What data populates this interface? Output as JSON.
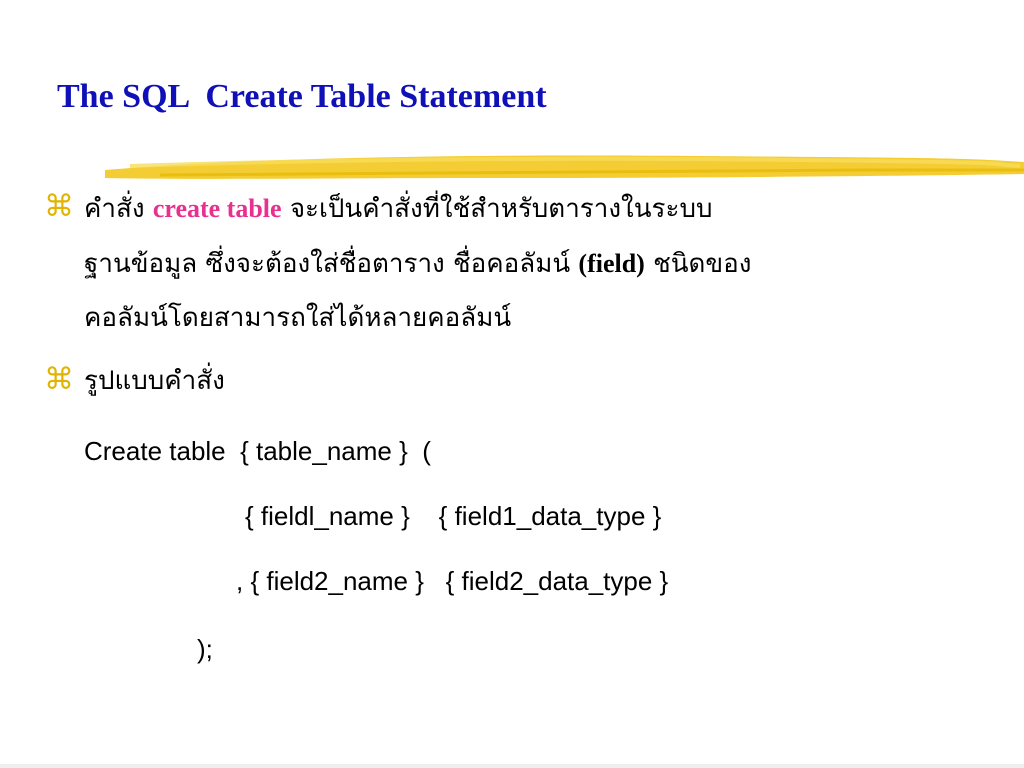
{
  "slide": {
    "title": "The SQL  Create Table Statement",
    "bullet_icon": "command-key-icon",
    "accent_color": "#e0b400",
    "title_color": "#1010b8",
    "keyword_color": "#e8308e",
    "bullets": [
      {
        "line1_pre": "คำสั่ง ",
        "line1_keyword": "create table",
        "line1_post": " จะเป็นคำสั่งที่ใช้สำหรับตารางในระบบ",
        "line2_pre": "ฐานข้อมูล ซึ่งจะต้องใส่ชื่อตาราง ชื่อคอลัมน์ ",
        "line2_keyword": "(field)",
        "line2_post": " ชนิดของ",
        "line3": "คอลัมน์โดยสามารถใส่ได้หลายคอลัมน์"
      },
      {
        "text": "รูปแบบคำสั่ง"
      }
    ],
    "syntax": [
      "Create table  { table_name }  (",
      "{ fieldl_name }    { field1_data_type }",
      ", { field2_name }   { field2_data_type }",
      ");"
    ]
  }
}
